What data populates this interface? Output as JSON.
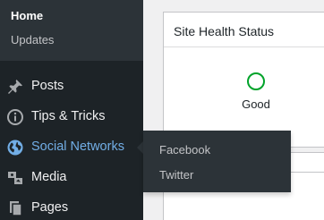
{
  "sidebar": {
    "submenu": {
      "home": "Home",
      "updates": "Updates"
    },
    "items": [
      {
        "label": "Posts",
        "icon": "pin-icon"
      },
      {
        "label": "Tips & Tricks",
        "icon": "info-icon"
      },
      {
        "label": "Social Networks",
        "icon": "globe-icon",
        "active": true
      },
      {
        "label": "Media",
        "icon": "media-icon"
      },
      {
        "label": "Pages",
        "icon": "pages-icon"
      }
    ]
  },
  "flyout": {
    "items": [
      {
        "label": "Facebook"
      },
      {
        "label": "Twitter"
      }
    ]
  },
  "widgets": {
    "site_health": {
      "title": "Site Health Status",
      "status": "Good"
    }
  },
  "colors": {
    "sidebar_bg": "#1d2327",
    "submenu_bg": "#2c3338",
    "active_text": "#72aee6",
    "status_good": "#00a32a",
    "page_bg": "#f0f0f1"
  }
}
